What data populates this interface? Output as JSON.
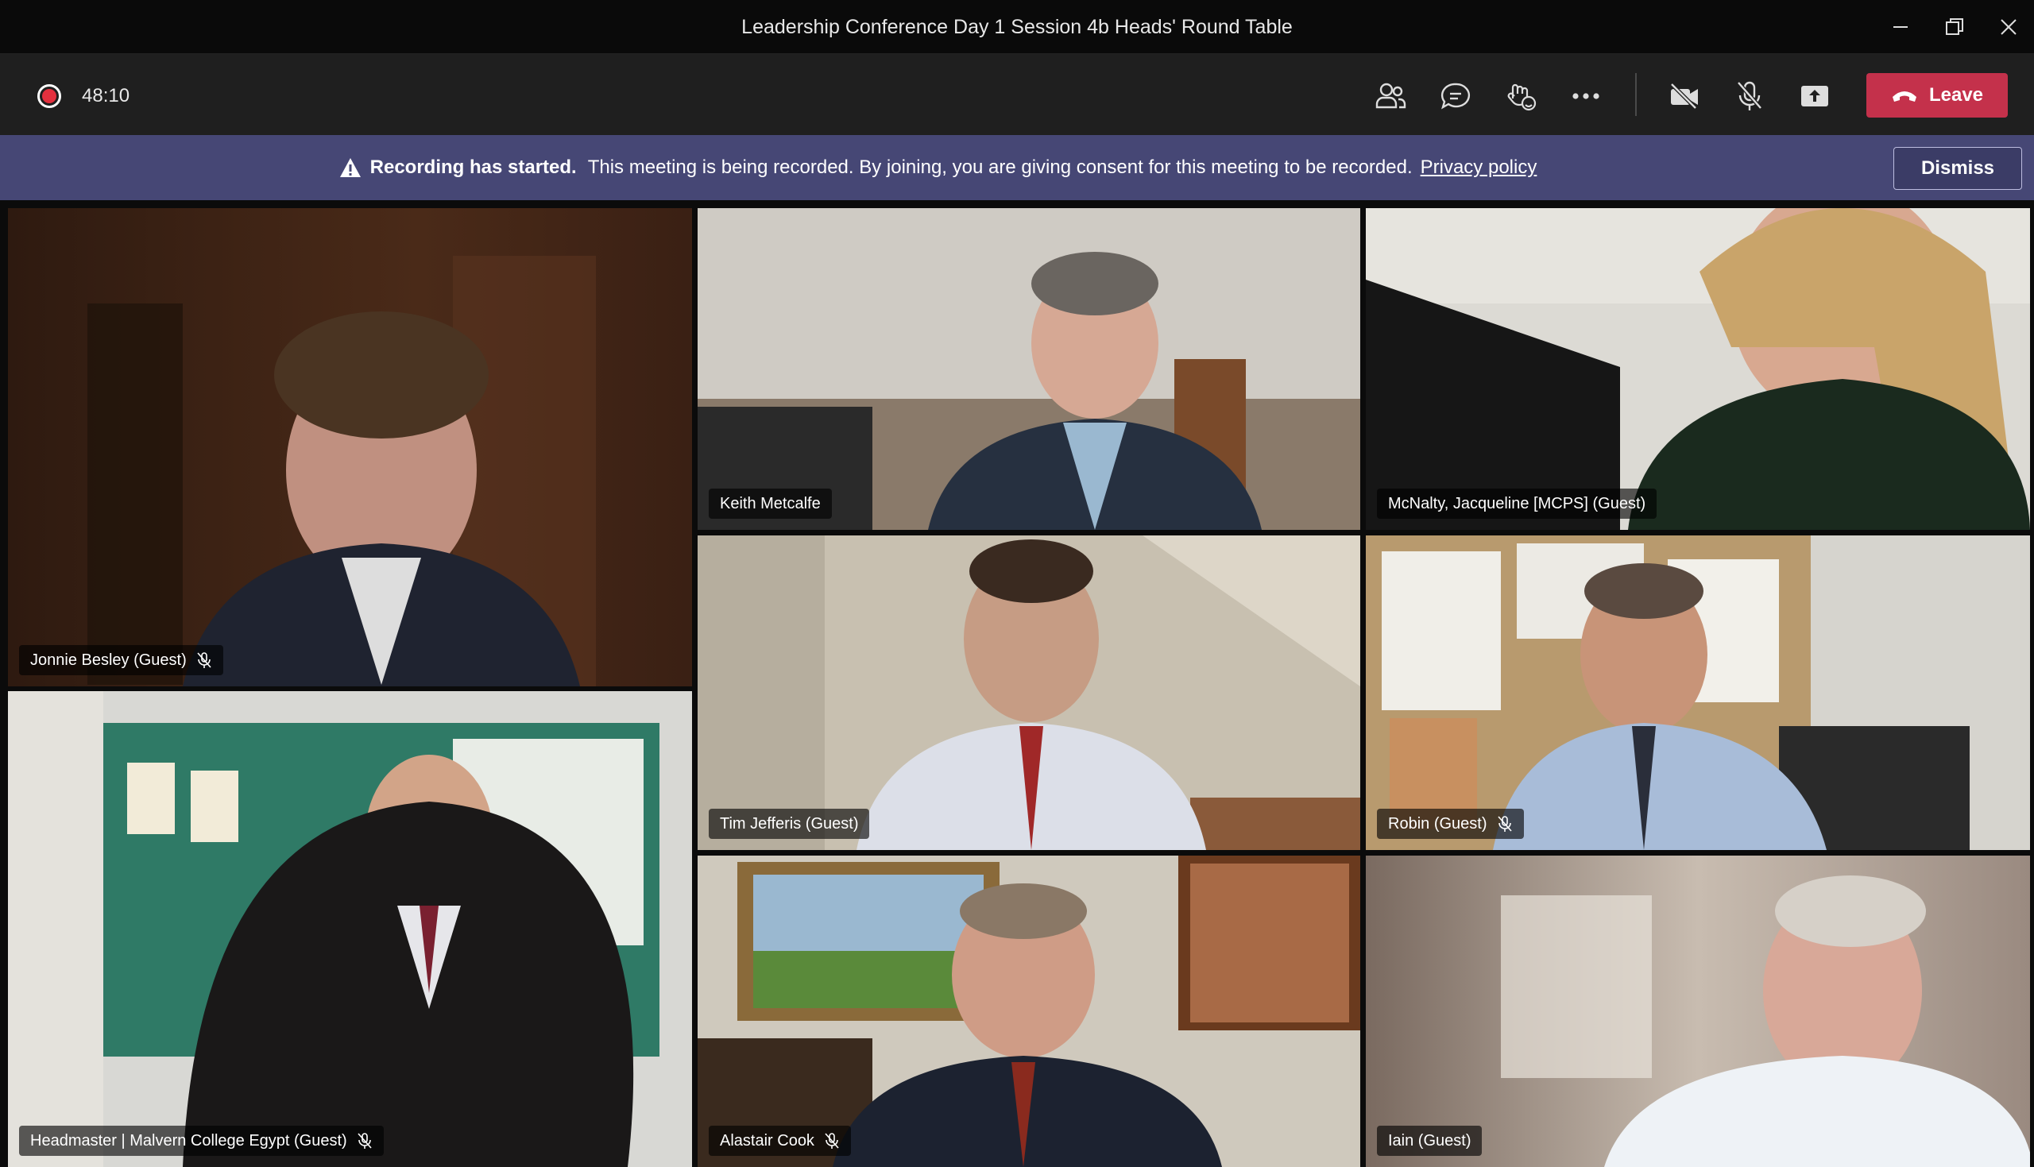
{
  "window": {
    "title": "Leadership Conference Day 1 Session 4b Heads' Round Table"
  },
  "toolbar": {
    "timer": "48:10",
    "leave_label": "Leave",
    "icons": [
      "participants-icon",
      "chat-icon",
      "reactions-icon",
      "more-options-icon",
      "camera-off-icon",
      "mic-muted-icon",
      "share-screen-icon"
    ]
  },
  "banner": {
    "bold": "Recording has started.",
    "text": "This meeting is being recorded. By joining, you are giving consent for this meeting to be recorded.",
    "link": "Privacy policy",
    "dismiss_label": "Dismiss"
  },
  "participants": [
    {
      "name": "Jonnie Besley (Guest)",
      "muted": true
    },
    {
      "name": "Keith Metcalfe",
      "muted": false
    },
    {
      "name": "McNalty, Jacqueline [MCPS] (Guest)",
      "muted": false
    },
    {
      "name": "Headmaster | Malvern College Egypt (Guest)",
      "muted": true
    },
    {
      "name": "Tim Jefferis (Guest)",
      "muted": false
    },
    {
      "name": "Robin (Guest)",
      "muted": true
    },
    {
      "name": "Alastair Cook",
      "muted": true
    },
    {
      "name": "Iain (Guest)",
      "muted": false
    }
  ],
  "colors": {
    "banner": "#464775",
    "leave": "#c4314b",
    "record": "#e3303e"
  }
}
